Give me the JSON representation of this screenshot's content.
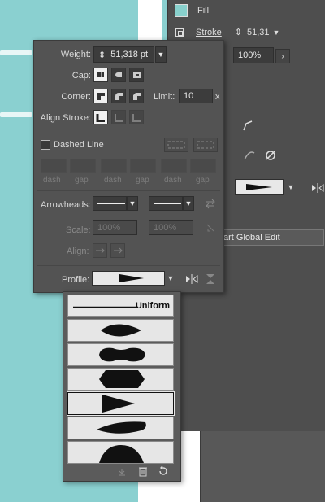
{
  "colors": {
    "accent_fill": "#88d0cc",
    "panel": "#535353"
  },
  "right_panel": {
    "fill_label": "Fill",
    "stroke_label": "Stroke",
    "stroke_weight": "51,31",
    "opacity_value": "100%",
    "global_edit_label": "art Global Edit"
  },
  "stroke": {
    "weight_label": "Weight:",
    "weight_value": "51,318 pt",
    "cap_label": "Cap:",
    "corner_label": "Corner:",
    "limit_label": "Limit:",
    "limit_value": "10",
    "limit_unit": "x",
    "align_label": "Align Stroke:",
    "dashed_label": "Dashed Line",
    "dash_labels": [
      "dash",
      "gap",
      "dash",
      "gap",
      "dash",
      "gap"
    ],
    "arrowheads_label": "Arrowheads:",
    "scale_label": "Scale:",
    "scale_values": [
      "100%",
      "100%"
    ],
    "align_arrow_label": "Align:",
    "profile_label": "Profile:"
  },
  "profiles": {
    "uniform_label": "Uniform",
    "items": [
      "uniform",
      "width-profile-1",
      "width-profile-2",
      "width-profile-3",
      "width-profile-4",
      "width-profile-5",
      "width-profile-6"
    ],
    "selected_index": 4
  }
}
